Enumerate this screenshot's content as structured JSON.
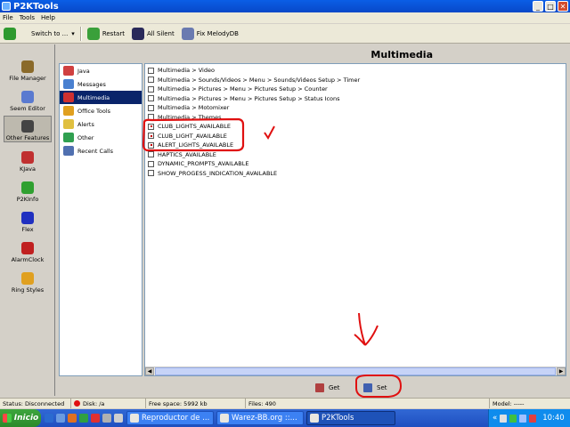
{
  "window": {
    "title": "P2KTools"
  },
  "menu": [
    "File",
    "Tools",
    "Help"
  ],
  "toolbar": {
    "switch_label": "Switch to ...",
    "restart_label": "Restart",
    "all_silent_label": "All Silent",
    "fix_melody_label": "Fix MelodyDB"
  },
  "sidebar": [
    {
      "label": "File Manager",
      "color": "#8a6a2a"
    },
    {
      "label": "Seem Editor",
      "color": "#5a7ad0"
    },
    {
      "label": "Other Features",
      "color": "#444444",
      "active": true
    },
    {
      "label": "KJava",
      "color": "#c03030"
    },
    {
      "label": "P2KInfo",
      "color": "#30a030"
    },
    {
      "label": "Flex",
      "color": "#2030c0"
    },
    {
      "label": "AlarmClock",
      "color": "#c02020"
    },
    {
      "label": "Ring Styles",
      "color": "#e0a020"
    }
  ],
  "features": [
    {
      "label": "Java",
      "color": "#d04040"
    },
    {
      "label": "Messages",
      "color": "#4a80d0"
    },
    {
      "label": "Multimedia",
      "color": "#d03030",
      "selected": true
    },
    {
      "label": "Office Tools",
      "color": "#e0a020"
    },
    {
      "label": "Alerts",
      "color": "#e0c040"
    },
    {
      "label": "Other",
      "color": "#30a050"
    },
    {
      "label": "Recent Calls",
      "color": "#5070b0"
    }
  ],
  "panel": {
    "title": "Multimedia"
  },
  "options": [
    {
      "label": "Multimedia > Video",
      "checked": false
    },
    {
      "label": "Multimedia > Sounds/Videos > Menu > Sounds/Videos Setup > Timer",
      "checked": false
    },
    {
      "label": "Multimedia > Pictures > Menu > Pictures Setup > Counter",
      "checked": false
    },
    {
      "label": "Multimedia > Pictures > Menu > Pictures Setup > Status Icons",
      "checked": false
    },
    {
      "label": "Multimedia > Motomixer",
      "checked": false
    },
    {
      "label": "Multimedia > Themes",
      "checked": false
    },
    {
      "label": "CLUB_LIGHTS_AVAILABLE",
      "checked": true
    },
    {
      "label": "CLUB_LIGHT_AVAILABLE",
      "checked": true
    },
    {
      "label": "ALERT_LIGHTS_AVAILABLE",
      "checked": true
    },
    {
      "label": "HAPTICS_AVAILABLE",
      "checked": false
    },
    {
      "label": "DYNAMIC_PROMPTS_AVAILABLE",
      "checked": false
    },
    {
      "label": "SHOW_PROGESS_INDICATION_AVAILABLE",
      "checked": false
    }
  ],
  "actions": {
    "get_label": "Get",
    "set_label": "Set"
  },
  "status": {
    "connection": "Status: Disconnected",
    "disk": "Disk: /a",
    "free_space": "Free space: 5992 kb",
    "files": "Files: 490",
    "model": "Model: -----"
  },
  "taskbar": {
    "start_label": "Inicio",
    "tasks": [
      {
        "label": "Reproductor de ...",
        "active": false
      },
      {
        "label": "Warez-BB.org ::...",
        "active": false
      },
      {
        "label": "P2KTools",
        "active": true
      }
    ],
    "clock": "10:40"
  }
}
